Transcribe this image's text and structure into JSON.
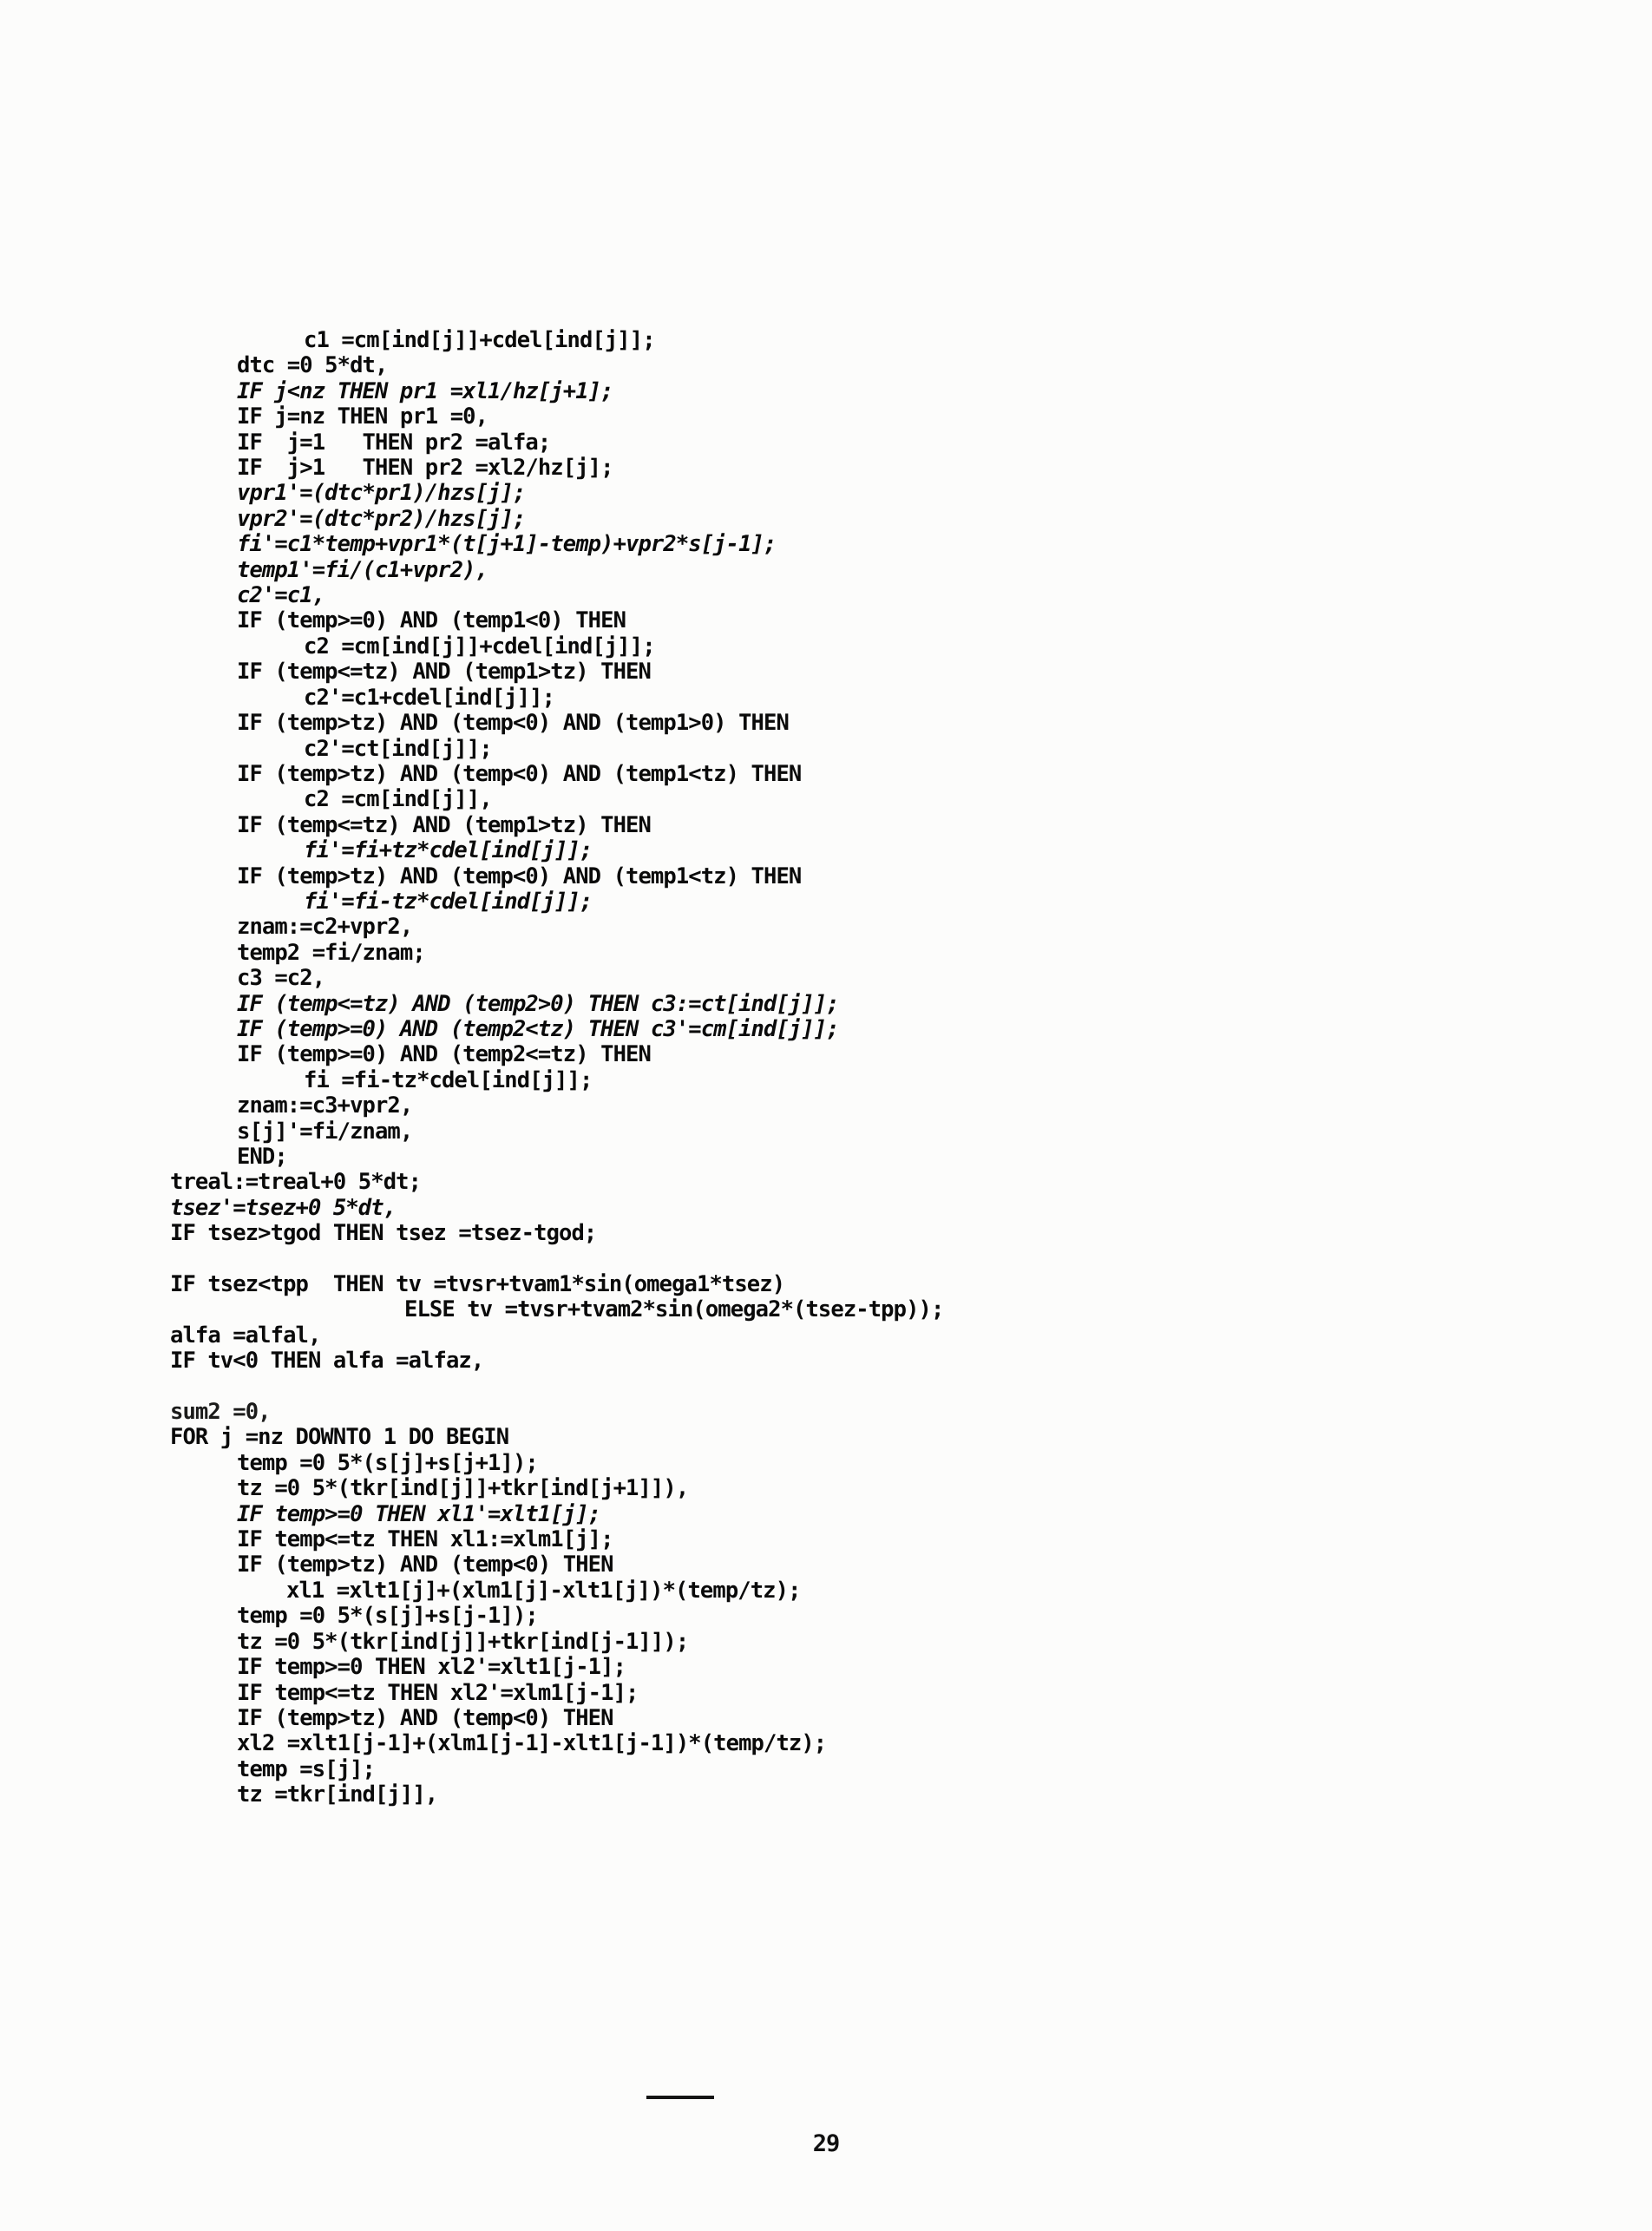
{
  "document": {
    "kind": "scanned-source-code-listing",
    "language_keywords": [
      "IF",
      "THEN",
      "ELSE",
      "AND",
      "FOR",
      "DOWNTO",
      "DO",
      "BEGIN",
      "END"
    ],
    "page_number": "29"
  },
  "code": {
    "lines": [
      {
        "indent": 3,
        "style": "kw",
        "text": "c1 =cm[ind[j]]+cdel[ind[j]];"
      },
      {
        "indent": 1,
        "style": "kw",
        "text": "dtc =0 5*dt,"
      },
      {
        "indent": 1,
        "style": "ital",
        "text": "IF j<nz THEN pr1 =xl1/hz[j+1];"
      },
      {
        "indent": 1,
        "style": "kw",
        "text": "IF j=nz THEN pr1 =0,"
      },
      {
        "indent": 1,
        "style": "kw",
        "text": "IF  j=1   THEN pr2 =alfa;"
      },
      {
        "indent": 1,
        "style": "kw",
        "text": "IF  j>1   THEN pr2 =xl2/hz[j];"
      },
      {
        "indent": 1,
        "style": "ital",
        "text": "vpr1'=(dtc*pr1)/hzs[j];"
      },
      {
        "indent": 1,
        "style": "ital",
        "text": "vpr2'=(dtc*pr2)/hzs[j];"
      },
      {
        "indent": 1,
        "style": "ital",
        "text": "fi'=c1*temp+vpr1*(t[j+1]-temp)+vpr2*s[j-1];"
      },
      {
        "indent": 1,
        "style": "ital",
        "text": "temp1'=fi/(c1+vpr2),"
      },
      {
        "indent": 1,
        "style": "ital",
        "text": "c2'=c1,"
      },
      {
        "indent": 1,
        "style": "kw",
        "text": "IF (temp>=0) AND (temp1<0) THEN"
      },
      {
        "indent": 3,
        "style": "kw",
        "text": "c2 =cm[ind[j]]+cdel[ind[j]];"
      },
      {
        "indent": 1,
        "style": "kw",
        "text": "IF (temp<=tz) AND (temp1>tz) THEN"
      },
      {
        "indent": 3,
        "style": "kw",
        "text": "c2'=c1+cdel[ind[j]];"
      },
      {
        "indent": 1,
        "style": "kw",
        "text": "IF (temp>tz) AND (temp<0) AND (temp1>0) THEN"
      },
      {
        "indent": 3,
        "style": "kw",
        "text": "c2'=ct[ind[j]];"
      },
      {
        "indent": 1,
        "style": "kw",
        "text": "IF (temp>tz) AND (temp<0) AND (temp1<tz) THEN"
      },
      {
        "indent": 3,
        "style": "kw",
        "text": "c2 =cm[ind[j]],"
      },
      {
        "indent": 1,
        "style": "kw",
        "text": "IF (temp<=tz) AND (temp1>tz) THEN"
      },
      {
        "indent": 3,
        "style": "ital",
        "text": "fi'=fi+tz*cdel[ind[j]];"
      },
      {
        "indent": 1,
        "style": "kw",
        "text": "IF (temp>tz) AND (temp<0) AND (temp1<tz) THEN"
      },
      {
        "indent": 3,
        "style": "ital",
        "text": "fi'=fi-tz*cdel[ind[j]];"
      },
      {
        "indent": 1,
        "style": "kw",
        "text": "znam:=c2+vpr2,"
      },
      {
        "indent": 1,
        "style": "kw",
        "text": "temp2 =fi/znam;"
      },
      {
        "indent": 1,
        "style": "kw",
        "text": "c3 =c2,"
      },
      {
        "indent": 1,
        "style": "ital",
        "text": "IF (temp<=tz) AND (temp2>0) THEN c3:=ct[ind[j]];"
      },
      {
        "indent": 1,
        "style": "ital",
        "text": "IF (temp>=0) AND (temp2<tz) THEN c3'=cm[ind[j]];"
      },
      {
        "indent": 1,
        "style": "kw",
        "text": "IF (temp>=0) AND (temp2<=tz) THEN"
      },
      {
        "indent": 3,
        "style": "kw",
        "text": "fi =fi-tz*cdel[ind[j]];"
      },
      {
        "indent": 1,
        "style": "kw",
        "text": "znam:=c3+vpr2,"
      },
      {
        "indent": 1,
        "style": "kw",
        "text": "s[j]'=fi/znam,"
      },
      {
        "indent": 1,
        "style": "kw",
        "text": "END;"
      },
      {
        "indent": 0,
        "style": "kw",
        "text": "treal:=treal+0 5*dt;"
      },
      {
        "indent": 0,
        "style": "ital",
        "text": "tsez'=tsez+0 5*dt,"
      },
      {
        "indent": 0,
        "style": "kw",
        "text": "IF tsez>tgod THEN tsez =tsez-tgod;"
      },
      {
        "indent": 0,
        "style": "blank",
        "text": ""
      },
      {
        "indent": 0,
        "style": "kw",
        "text": "IF tsez<tpp  THEN tv =tvsr+tvam1*sin(omega1*tsez)"
      },
      {
        "indent": 4,
        "style": "kw",
        "text": "ELSE tv =tvsr+tvam2*sin(omega2*(tsez-tpp));"
      },
      {
        "indent": 0,
        "style": "kw",
        "text": "alfa =alfal,"
      },
      {
        "indent": 0,
        "style": "kw",
        "text": "IF tv<0 THEN alfa =alfaz,"
      },
      {
        "indent": 0,
        "style": "blank",
        "text": ""
      },
      {
        "indent": 0,
        "style": "light",
        "text": "sum2 =0,"
      },
      {
        "indent": 0,
        "style": "kw",
        "text": "FOR j =nz DOWNTO 1 DO BEGIN"
      },
      {
        "indent": 1,
        "style": "kw",
        "text": "temp =0 5*(s[j]+s[j+1]);"
      },
      {
        "indent": 1,
        "style": "kw",
        "text": "tz =0 5*(tkr[ind[j]]+tkr[ind[j+1]]),"
      },
      {
        "indent": 1,
        "style": "ital",
        "text": "IF temp>=0 THEN xl1'=xlt1[j];"
      },
      {
        "indent": 1,
        "style": "kw",
        "text": "IF temp<=tz THEN xl1:=xlm1[j];"
      },
      {
        "indent": 1,
        "style": "kw",
        "text": "IF (temp>tz) AND (temp<0) THEN"
      },
      {
        "indent": 2,
        "style": "kw",
        "text": "xl1 =xlt1[j]+(xlm1[j]-xlt1[j])*(temp/tz);"
      },
      {
        "indent": 1,
        "style": "kw",
        "text": "temp =0 5*(s[j]+s[j-1]);"
      },
      {
        "indent": 1,
        "style": "kw",
        "text": "tz =0 5*(tkr[ind[j]]+tkr[ind[j-1]]);"
      },
      {
        "indent": 1,
        "style": "kw",
        "text": "IF temp>=0 THEN xl2'=xlt1[j-1];"
      },
      {
        "indent": 1,
        "style": "kw",
        "text": "IF temp<=tz THEN xl2'=xlm1[j-1];"
      },
      {
        "indent": 1,
        "style": "kw",
        "text": "IF (temp>tz) AND (temp<0) THEN"
      },
      {
        "indent": 1,
        "style": "kw",
        "text": "xl2 =xlt1[j-1]+(xlm1[j-1]-xlt1[j-1])*(temp/tz);"
      },
      {
        "indent": 1,
        "style": "kw",
        "text": "temp =s[j];"
      },
      {
        "indent": 1,
        "style": "kw",
        "text": "tz =tkr[ind[j]],"
      }
    ]
  },
  "footer": {
    "page_number": "29"
  }
}
